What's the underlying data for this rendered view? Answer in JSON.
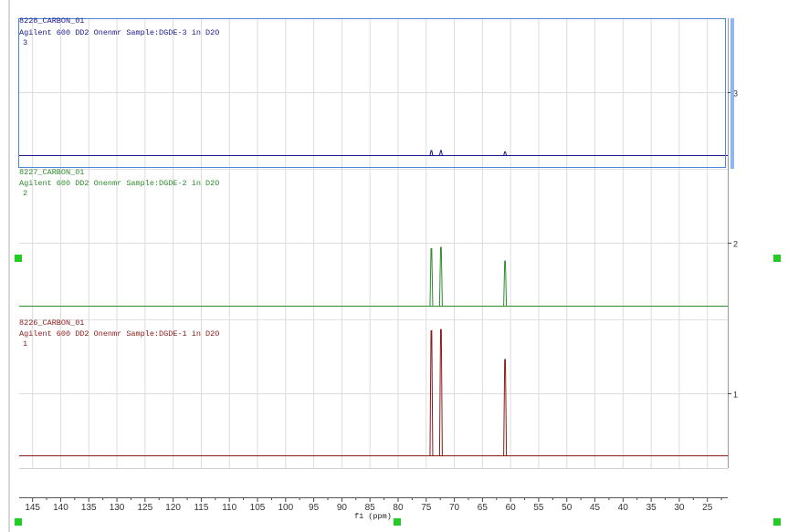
{
  "chart_data": {
    "type": "line",
    "title": "",
    "xlabel": "f1 (ppm)",
    "ylabel": "",
    "xlim": [
      147.3,
      21.3
    ],
    "x_ticks": [
      145,
      140,
      135,
      130,
      125,
      120,
      115,
      110,
      105,
      100,
      95,
      90,
      85,
      80,
      75,
      70,
      65,
      60,
      55,
      50,
      45,
      40,
      35,
      30,
      25
    ],
    "y_ticks": [
      "1",
      "2",
      "3"
    ],
    "grid": true,
    "series": [
      {
        "name": "3",
        "id": "8228_CARBON_01",
        "description": "Agilent 600 DD2 Onenmr Sample:DGDE-3 in D2O",
        "color": "#1a1a8c",
        "peaks_ppm": [
          74.0,
          72.3,
          60.9
        ],
        "intensities": [
          0.04,
          0.04,
          0.03
        ]
      },
      {
        "name": "2",
        "id": "8227_CARBON_01",
        "description": "Agilent 600 DD2 Onenmr Sample:DGDE-2 in D2O",
        "color": "#2e8b2e",
        "peaks_ppm": [
          74.0,
          72.3,
          60.9
        ],
        "intensities": [
          0.46,
          0.47,
          0.36
        ]
      },
      {
        "name": "1",
        "id": "8226_CARBON_01",
        "description": "Agilent 600 DD2 Onenmr Sample:DGDE-1 in D2O",
        "color": "#8b1a1a",
        "peaks_ppm": [
          74.0,
          72.3,
          60.9
        ],
        "intensities": [
          1.0,
          1.01,
          0.77
        ]
      }
    ]
  }
}
